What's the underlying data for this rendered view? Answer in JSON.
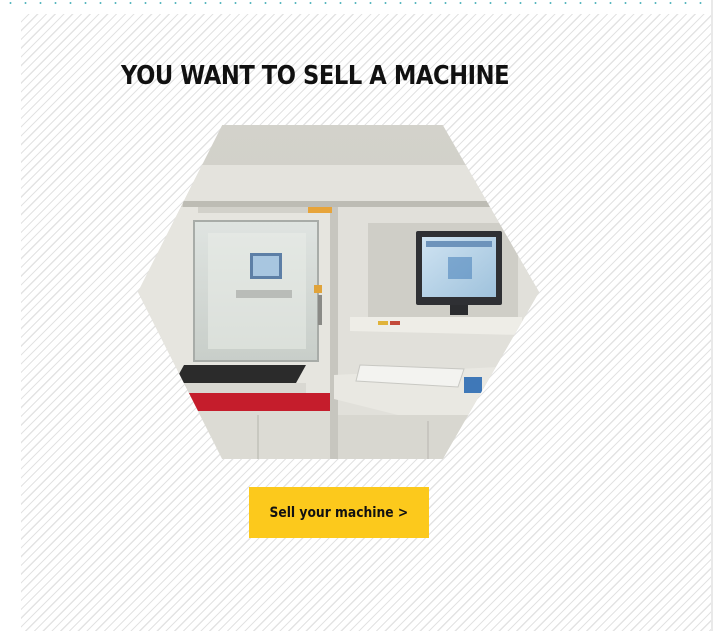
{
  "section": {
    "title": "YOU WANT TO SELL A MACHINE"
  },
  "image": {
    "subject": "industrial-machine-photo"
  },
  "cta": {
    "label": "Sell your machine >"
  },
  "colors": {
    "accent": "#fcc91c",
    "title_text": "#111111",
    "stripe": "#e3e3e3",
    "dot_border": "#5ab7bf"
  }
}
